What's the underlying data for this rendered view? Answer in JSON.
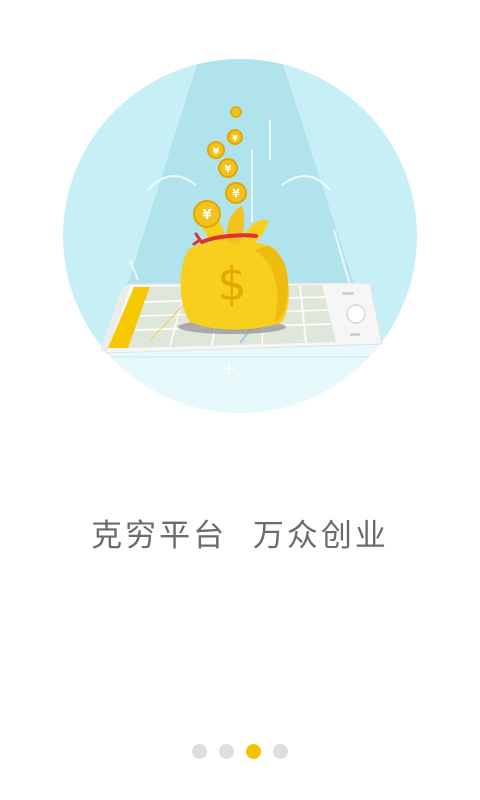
{
  "onboarding": {
    "slogan": "克穷平台  万众创业",
    "page_count": 4,
    "current_page": 3,
    "colors": {
      "circle_bg": "#c6f0f6",
      "beam": "#a9dfea",
      "coin": "#f4c21e",
      "bag": "#f7cf1c",
      "accent_red": "#e0322a",
      "phone_accent": "#f6c800",
      "dot_inactive": "#dedede",
      "dot_active": "#f3c300",
      "text": "#6b6b6b"
    },
    "icons": {
      "bag_symbol": "$",
      "coin_symbol": "¥"
    }
  }
}
